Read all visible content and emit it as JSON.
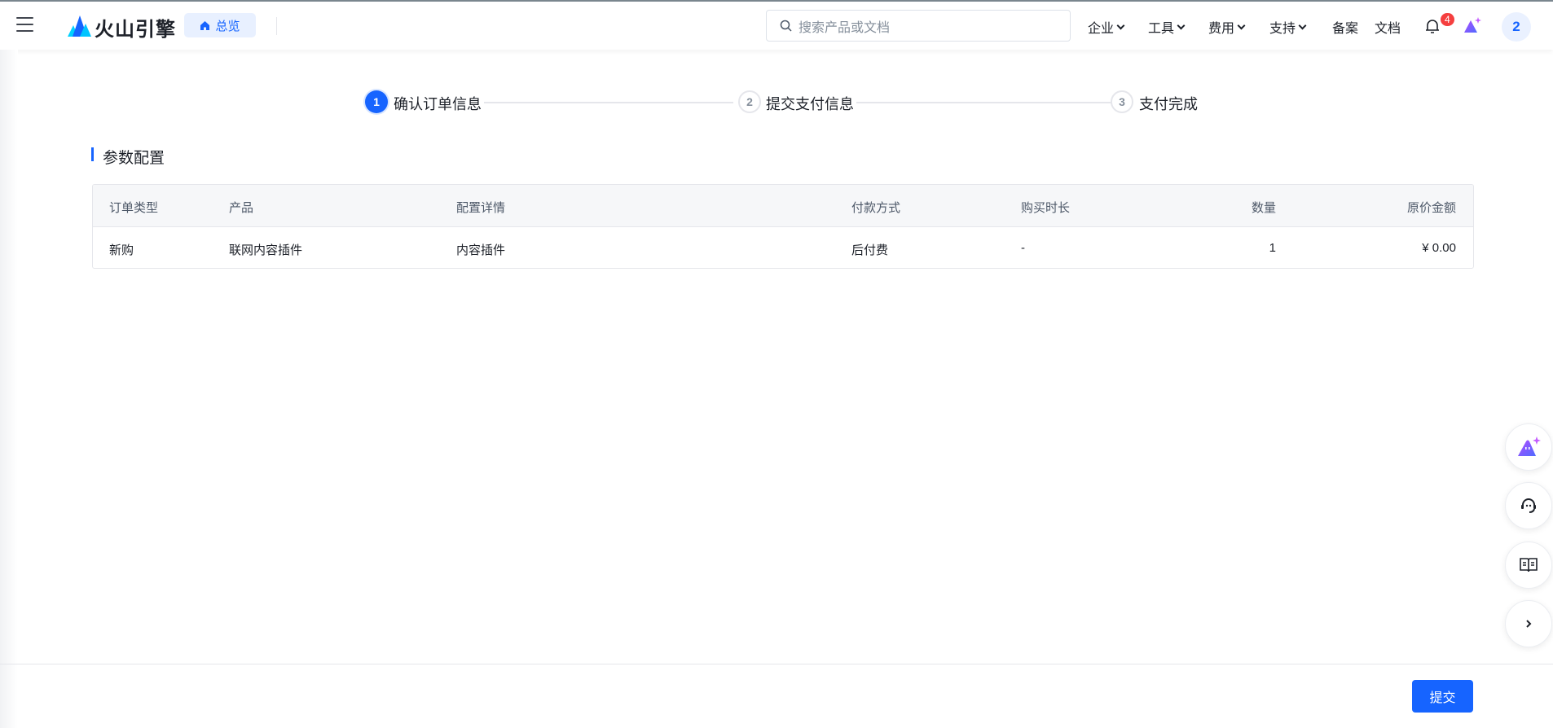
{
  "header": {
    "brand": "火山引擎",
    "home_pill": "总览",
    "search_placeholder": "搜索产品或文档",
    "nav": [
      {
        "label": "企业"
      },
      {
        "label": "工具"
      },
      {
        "label": "费用"
      },
      {
        "label": "支持"
      },
      {
        "label": "备案"
      },
      {
        "label": "文档"
      }
    ],
    "notification_count": "4",
    "avatar_text": "2"
  },
  "steps": [
    {
      "num": "1",
      "label": "确认订单信息",
      "status": "active"
    },
    {
      "num": "2",
      "label": "提交支付信息",
      "status": "pending"
    },
    {
      "num": "3",
      "label": "支付完成",
      "status": "pending"
    }
  ],
  "section_title": "参数配置",
  "table": {
    "columns": [
      "订单类型",
      "产品",
      "配置详情",
      "付款方式",
      "购买时长",
      "数量",
      "原价金额"
    ],
    "rows": [
      [
        "新购",
        "联网内容插件",
        "内容插件",
        "后付费",
        "-",
        "1",
        "¥ 0.00"
      ]
    ]
  },
  "footer": {
    "submit_label": "提交"
  },
  "colors": {
    "accent": "#1664ff",
    "badge": "#f53f3f"
  }
}
